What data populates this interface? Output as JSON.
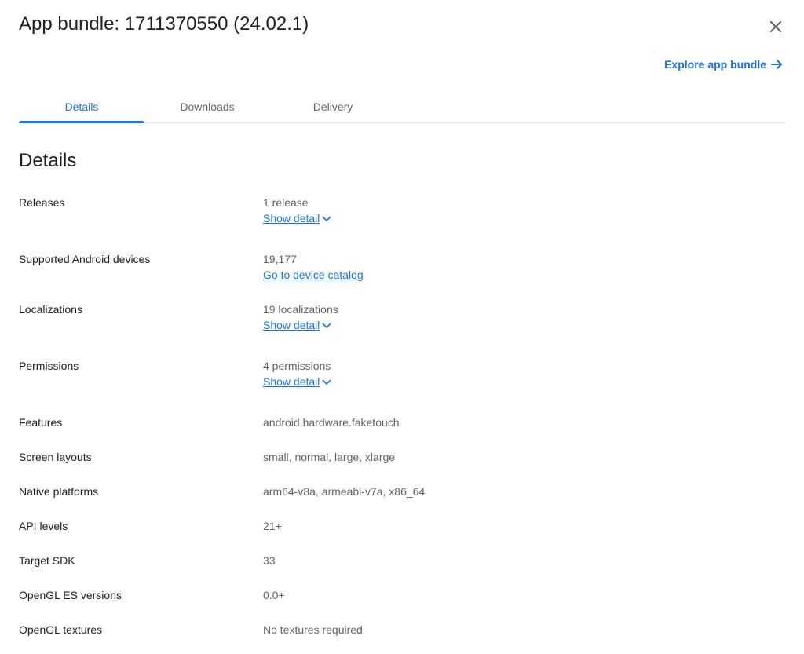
{
  "dialog": {
    "title": "App bundle: 1711370550 (24.02.1)",
    "close_icon": "close-icon",
    "explore_label": "Explore app bundle",
    "explore_icon": "arrow-right-icon"
  },
  "tabs": [
    {
      "label": "Details",
      "active": true
    },
    {
      "label": "Downloads",
      "active": false
    },
    {
      "label": "Delivery",
      "active": false
    }
  ],
  "section_title": "Details",
  "rows": {
    "releases": {
      "label": "Releases",
      "value": "1 release",
      "link": "Show detail"
    },
    "devices": {
      "label": "Supported Android devices",
      "value": "19,177",
      "link": "Go to device catalog"
    },
    "localizations": {
      "label": "Localizations",
      "value": "19 localizations",
      "link": "Show detail"
    },
    "permissions": {
      "label": "Permissions",
      "value": "4 permissions",
      "link": "Show detail"
    },
    "features": {
      "label": "Features",
      "value": "android.hardware.faketouch"
    },
    "screen_layouts": {
      "label": "Screen layouts",
      "value": "small, normal, large, xlarge"
    },
    "native_platforms": {
      "label": "Native platforms",
      "value": "arm64-v8a, armeabi-v7a, x86_64"
    },
    "api_levels": {
      "label": "API levels",
      "value": "21+"
    },
    "target_sdk": {
      "label": "Target SDK",
      "value": "33"
    },
    "opengl_versions": {
      "label": "OpenGL ES versions",
      "value": "0.0+"
    },
    "opengl_textures": {
      "label": "OpenGL textures",
      "value": "No textures required"
    }
  },
  "colors": {
    "accent": "#1a73e8",
    "text_primary": "#202124",
    "text_secondary": "#5f6368",
    "divider": "#dadce0"
  }
}
